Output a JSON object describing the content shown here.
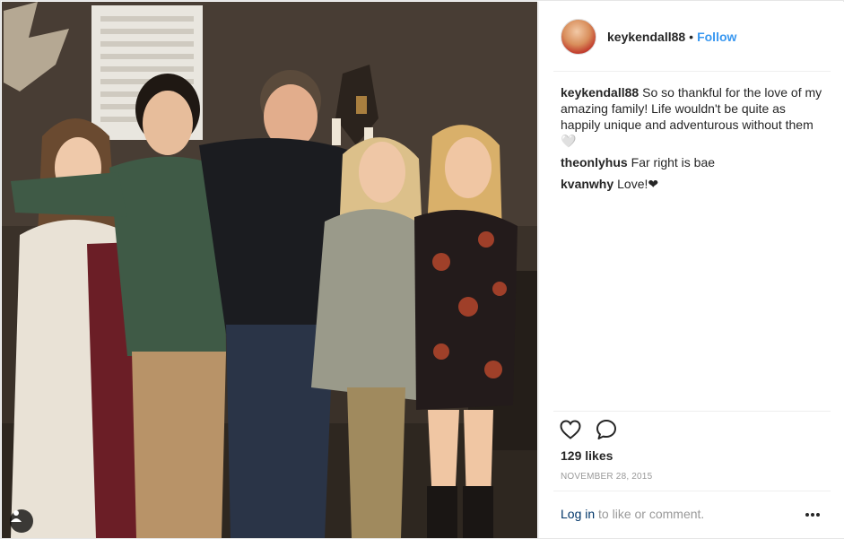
{
  "post": {
    "username": "keykendall88",
    "separator": "•",
    "follow_label": "Follow"
  },
  "comments": [
    {
      "user": "keykendall88",
      "text": "So so thankful for the love of my amazing family! Life wouldn't be quite as happily unique and adventurous without them 🤍"
    },
    {
      "user": "theonlyhus",
      "text": "Far right is bae"
    },
    {
      "user": "kvanwhy",
      "text": "Love!❤"
    }
  ],
  "stats": {
    "likes_label": "129 likes",
    "date": "NOVEMBER 28, 2015"
  },
  "footer": {
    "login_link": "Log in",
    "login_suffix": " to like or comment."
  },
  "icons": {
    "like": "heart-icon",
    "comment": "speech-bubble-icon",
    "more": "more-options-icon",
    "user_tag": "user-tag-icon"
  },
  "colors": {
    "follow": "#3897f0",
    "link": "#003569",
    "muted": "#999999",
    "text": "#262626"
  }
}
